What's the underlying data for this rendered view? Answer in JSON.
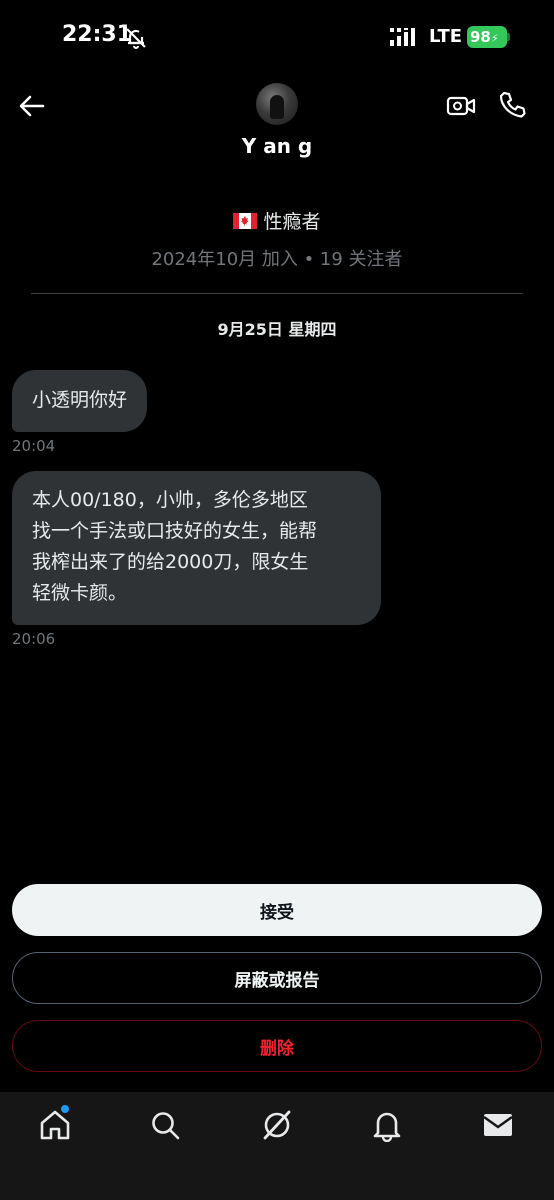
{
  "status_bar": {
    "time": "22:31",
    "network": "LTE",
    "battery": "98"
  },
  "header": {
    "username": "Y an g"
  },
  "profile": {
    "bio": "性瘾者",
    "joined": "2024年10月 加入 • 19 关注者"
  },
  "conversation": {
    "date": "9月25日 星期四",
    "messages": [
      {
        "text": "小透明你好",
        "time": "20:04"
      },
      {
        "text": "本人00/180，小帅，多伦多地区\n找一个手法或口技好的女生，能帮\n我榨出来了的给2000刀，限女生\n轻微卡颜。",
        "time": "20:06"
      }
    ]
  },
  "actions": {
    "accept": "接受",
    "block_report": "屏蔽或报告",
    "delete": "删除"
  },
  "icons": {
    "back": "back-arrow-icon",
    "video": "video-call-icon",
    "phone": "phone-icon",
    "home": "home-icon",
    "search": "search-icon",
    "grok": "grok-icon",
    "notifications": "bell-icon",
    "messages": "mail-icon"
  },
  "colors": {
    "accent": "#1d9bf0",
    "danger": "#f4212e",
    "bubble": "#2f3336",
    "battery": "#34c759"
  }
}
